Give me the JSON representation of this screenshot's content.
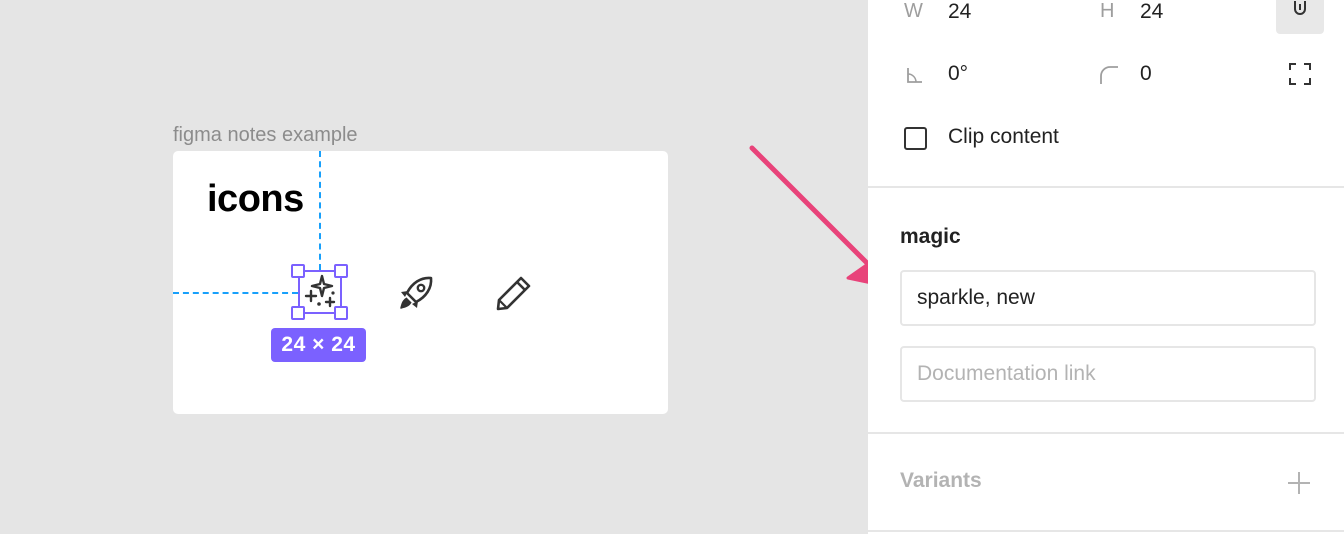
{
  "canvas": {
    "frame_label": "figma notes example",
    "frame_title": "icons",
    "selection_size": "24 × 24",
    "icons": [
      {
        "name": "sparkle-icon",
        "selected": true
      },
      {
        "name": "rocket-icon",
        "selected": false
      },
      {
        "name": "pencil-icon",
        "selected": false
      }
    ],
    "annotation_color": "#e8437a",
    "selection_color": "#7b61ff",
    "guide_color": "#18a0fb"
  },
  "panel": {
    "width_label": "W",
    "width_value": "24",
    "height_label": "H",
    "height_value": "24",
    "rotation_value": "0°",
    "radius_value": "0",
    "clip_content_label": "Clip content",
    "clip_content_checked": false,
    "component_name": "magic",
    "description_value": "sparkle, new",
    "documentation_placeholder": "Documentation link",
    "variants_label": "Variants"
  }
}
